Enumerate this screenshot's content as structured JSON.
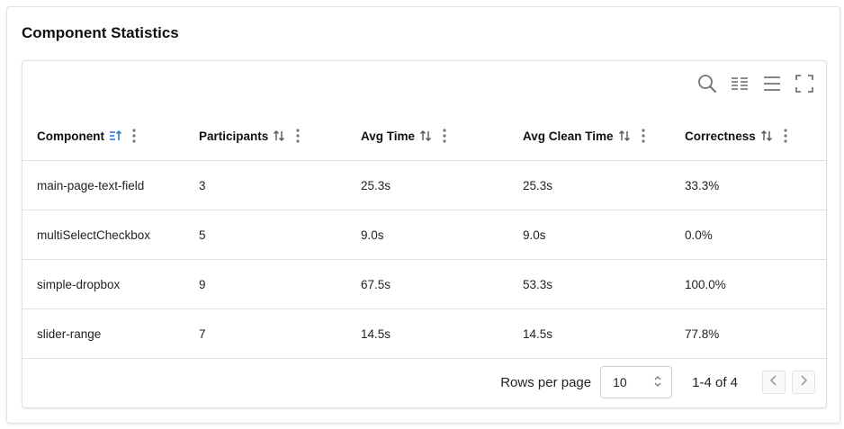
{
  "card": {
    "title": "Component Statistics"
  },
  "toolbar": {
    "icons": [
      "search-icon",
      "columns-icon",
      "density-icon",
      "fullscreen-icon"
    ]
  },
  "table": {
    "headers": {
      "component": "Component",
      "participants": "Participants",
      "avg_time": "Avg Time",
      "avg_clean_time": "Avg Clean Time",
      "correctness": "Correctness"
    },
    "sorted_column": "component",
    "sort_direction": "asc",
    "rows": [
      {
        "component": "main-page-text-field",
        "participants": "3",
        "avg_time": "25.3s",
        "avg_clean_time": "25.3s",
        "correctness": "33.3%"
      },
      {
        "component": "multiSelectCheckbox",
        "participants": "5",
        "avg_time": "9.0s",
        "avg_clean_time": "9.0s",
        "correctness": "0.0%"
      },
      {
        "component": "simple-dropbox",
        "participants": "9",
        "avg_time": "67.5s",
        "avg_clean_time": "53.3s",
        "correctness": "100.0%"
      },
      {
        "component": "slider-range",
        "participants": "7",
        "avg_time": "14.5s",
        "avg_clean_time": "14.5s",
        "correctness": "77.8%"
      }
    ]
  },
  "pagination": {
    "rows_per_page_label": "Rows per page",
    "rows_per_page_value": "10",
    "range": "1-4 of 4"
  },
  "colors": {
    "accent": "#1976d2",
    "icon": "#757575",
    "border": "#e0e0e0"
  }
}
